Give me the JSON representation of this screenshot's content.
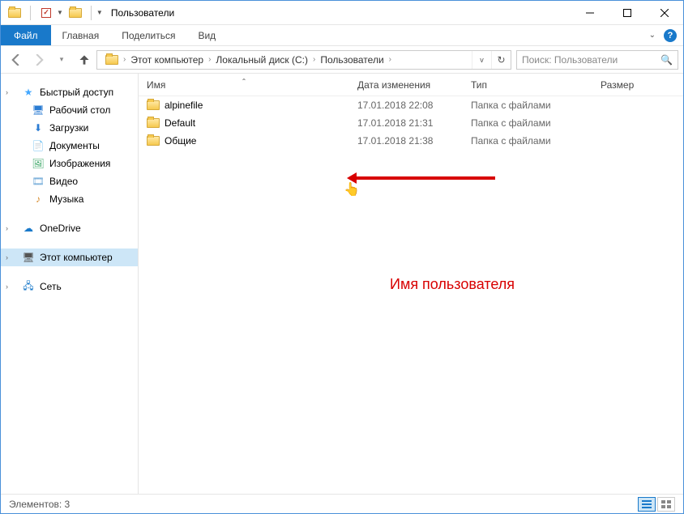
{
  "window": {
    "title": "Пользователи"
  },
  "ribbon": {
    "file": "Файл",
    "tabs": [
      "Главная",
      "Поделиться",
      "Вид"
    ]
  },
  "breadcrumbs": [
    "Этот компьютер",
    "Локальный диск (C:)",
    "Пользователи"
  ],
  "search": {
    "placeholder": "Поиск: Пользователи"
  },
  "columns": {
    "name": "Имя",
    "date": "Дата изменения",
    "type": "Тип",
    "size": "Размер"
  },
  "sidebar": {
    "quick": "Быстрый доступ",
    "quick_items": [
      {
        "label": "Рабочий стол",
        "icon": "desktop"
      },
      {
        "label": "Загрузки",
        "icon": "downloads"
      },
      {
        "label": "Документы",
        "icon": "documents"
      },
      {
        "label": "Изображения",
        "icon": "pictures"
      },
      {
        "label": "Видео",
        "icon": "videos"
      },
      {
        "label": "Музыка",
        "icon": "music"
      }
    ],
    "onedrive": "OneDrive",
    "thispc": "Этот компьютер",
    "network": "Сеть"
  },
  "rows": [
    {
      "name": "alpinefile",
      "date": "17.01.2018 22:08",
      "type": "Папка с файлами"
    },
    {
      "name": "Default",
      "date": "17.01.2018 21:31",
      "type": "Папка с файлами"
    },
    {
      "name": "Общие",
      "date": "17.01.2018 21:38",
      "type": "Папка с файлами"
    }
  ],
  "status": {
    "count": "Элементов: 3"
  },
  "annotation": {
    "label": "Имя пользователя"
  }
}
